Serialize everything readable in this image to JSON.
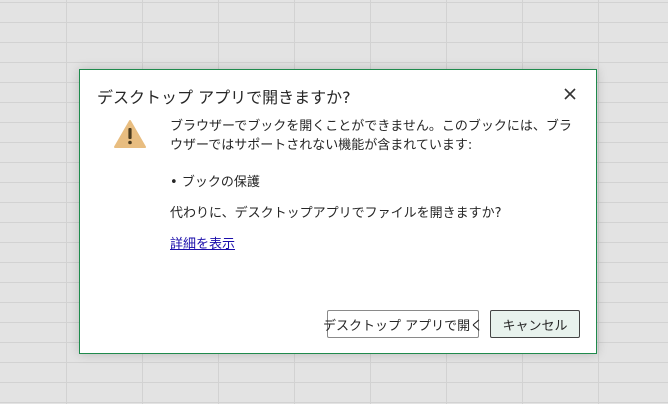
{
  "dialog": {
    "title": "デスクトップ アプリで開きますか?",
    "message": "ブラウザーでブックを開くことができません。このブックには、ブラウザーではサポートされない機能が含まれています:",
    "bullet_marker": "•",
    "feature_item": "ブックの保護",
    "question": "代わりに、デスクトップアプリでファイルを開きますか?",
    "details_link": "詳細を表示",
    "open_button_label": "デスクトップ アプリで開く",
    "cancel_button_label": "キャンセル"
  },
  "icons": {
    "close": "close-icon",
    "warning": "warning-icon"
  },
  "colors": {
    "dialog_border": "#1f8a4c",
    "warning_fill": "#e8bd80",
    "link": "#1a0dab",
    "cancel_button_bg": "#e8f2ed"
  }
}
